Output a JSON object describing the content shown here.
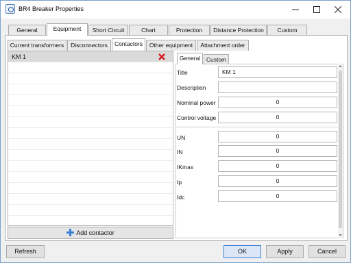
{
  "window": {
    "title": "BR4 Breaker Properties",
    "icon": "app-logo-icon",
    "controls": [
      "minimize-icon",
      "maximize-icon",
      "close-icon"
    ]
  },
  "main_tabs": [
    {
      "label": "General"
    },
    {
      "label": "Equipment",
      "selected": true
    },
    {
      "label": "Short Circuit"
    },
    {
      "label": "Chart"
    },
    {
      "label": "Protection"
    },
    {
      "label": "Distance Protection"
    },
    {
      "label": "Custom"
    }
  ],
  "sub_tabs": [
    {
      "label": "Current transformers"
    },
    {
      "label": "Disconnectors"
    },
    {
      "label": "Contactors",
      "selected": true
    },
    {
      "label": "Other equipment"
    },
    {
      "label": "Attachment order"
    }
  ],
  "contactor_list": {
    "items": [
      {
        "name": "KM 1",
        "selected": true
      }
    ],
    "add_button": "Add contactor",
    "delete_icon": "delete-x-icon",
    "add_icon": "plus-icon"
  },
  "prop_tabs": [
    {
      "label": "General",
      "selected": true
    },
    {
      "label": "Custom"
    }
  ],
  "properties": {
    "title_label": "Title",
    "title_value": "KM 1",
    "description_label": "Description",
    "description_value": "",
    "nominal_power_label": "Nominal power",
    "nominal_power_value": "0",
    "control_voltage_label": "Control voltage",
    "control_voltage_value": "0",
    "un_label": "UN",
    "un_value": "0",
    "in_label": "IN",
    "in_value": "0",
    "ikmax_label": "IKmax",
    "ikmax_value": "0",
    "ip_label": "Ip",
    "ip_value": "0",
    "idc_label": "Idc",
    "idc_value": "0"
  },
  "footer": {
    "refresh": "Refresh",
    "ok": "OK",
    "apply": "Apply",
    "cancel": "Cancel"
  },
  "colors": {
    "delete": "#d7191f",
    "add": "#3a7fd5",
    "primary_border": "#3c7fd1"
  }
}
